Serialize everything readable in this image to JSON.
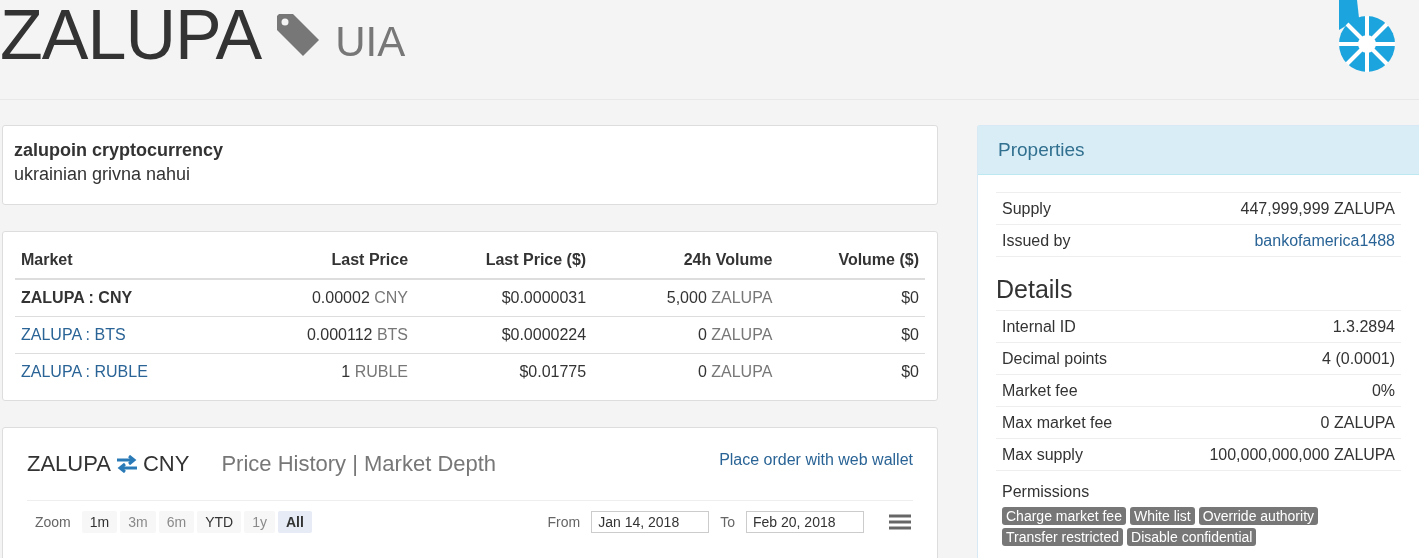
{
  "header": {
    "title": "ZALUPA",
    "type": "UIA"
  },
  "description": {
    "title": "zalupoin cryptocurrency",
    "text": "ukrainian grivna nahui"
  },
  "markets": {
    "columns": [
      "Market",
      "Last Price",
      "Last Price ($)",
      "24h Volume",
      "Volume ($)"
    ],
    "rows": [
      {
        "market": "ZALUPA : CNY",
        "selected": true,
        "last_price": "0.00002",
        "last_price_unit": "CNY",
        "last_price_usd": "$0.0000031",
        "volume": "5,000",
        "volume_unit": "ZALUPA",
        "volume_usd": "$0"
      },
      {
        "market": "ZALUPA : BTS",
        "selected": false,
        "last_price": "0.000112",
        "last_price_unit": "BTS",
        "last_price_usd": "$0.0000224",
        "volume": "0",
        "volume_unit": "ZALUPA",
        "volume_usd": "$0"
      },
      {
        "market": "ZALUPA : RUBLE",
        "selected": false,
        "last_price": "1",
        "last_price_unit": "RUBLE",
        "last_price_usd": "$0.01775",
        "volume": "0",
        "volume_unit": "ZALUPA",
        "volume_usd": "$0"
      }
    ]
  },
  "chart": {
    "base": "ZALUPA",
    "quote": "CNY",
    "title": "Price History | Market Depth",
    "link": "Place order with web wallet",
    "zoom_label": "Zoom",
    "ranges": [
      {
        "label": "1m",
        "selected": false,
        "disabled": false
      },
      {
        "label": "3m",
        "selected": false,
        "disabled": true
      },
      {
        "label": "6m",
        "selected": false,
        "disabled": true
      },
      {
        "label": "YTD",
        "selected": false,
        "disabled": false
      },
      {
        "label": "1y",
        "selected": false,
        "disabled": true
      },
      {
        "label": "All",
        "selected": true,
        "disabled": false
      }
    ],
    "from_label": "From",
    "from_value": "Jan 14, 2018",
    "to_label": "To",
    "to_value": "Feb 20, 2018"
  },
  "properties": {
    "title": "Properties",
    "rows": [
      {
        "label": "Supply",
        "value": "447,999,999 ZALUPA",
        "kind": "text"
      },
      {
        "label": "Issued by",
        "value": "bankofamerica1488",
        "kind": "link"
      }
    ]
  },
  "details": {
    "title": "Details",
    "rows": [
      {
        "label": "Internal ID",
        "value": "1.3.2894"
      },
      {
        "label": "Decimal points",
        "value": "4 (0.0001)"
      },
      {
        "label": "Market fee",
        "value": "0%"
      },
      {
        "label": "Max market fee",
        "value": "0 ZALUPA"
      },
      {
        "label": "Max supply",
        "value": "100,000,000,000 ZALUPA"
      }
    ]
  },
  "permissions": {
    "title": "Permissions",
    "tags": [
      "Charge market fee",
      "White list",
      "Override authority",
      "Transfer restricted",
      "Disable confidential"
    ]
  }
}
